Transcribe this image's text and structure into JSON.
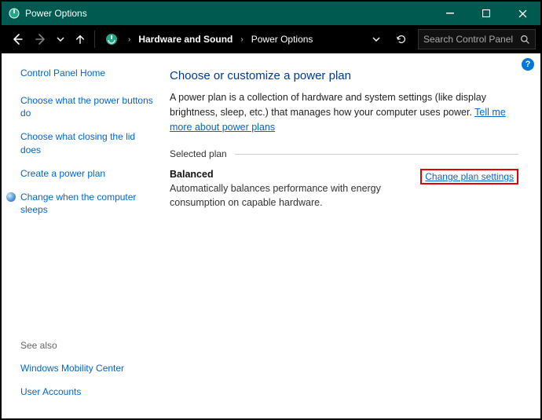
{
  "titlebar": {
    "title": "Power Options"
  },
  "breadcrumb": {
    "item1": "Hardware and Sound",
    "item2": "Power Options"
  },
  "search": {
    "placeholder": "Search Control Panel"
  },
  "sidebar": {
    "home": "Control Panel Home",
    "links": [
      "Choose what the power buttons do",
      "Choose what closing the lid does",
      "Create a power plan",
      "Change when the computer sleeps"
    ],
    "see_also_label": "See also",
    "see_also": [
      "Windows Mobility Center",
      "User Accounts"
    ]
  },
  "main": {
    "heading": "Choose or customize a power plan",
    "intro_text": "A power plan is a collection of hardware and system settings (like display brightness, sleep, etc.) that manages how your computer uses power. ",
    "intro_link": "Tell me more about power plans",
    "section_label": "Selected plan",
    "plan": {
      "name": "Balanced",
      "desc": "Automatically balances performance with energy consumption on capable hardware.",
      "change_link": "Change plan settings"
    }
  },
  "help_badge": "?"
}
